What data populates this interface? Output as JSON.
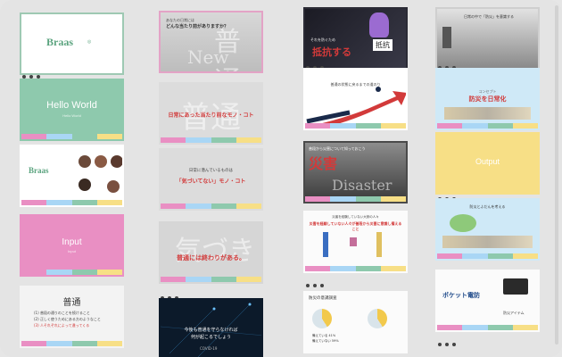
{
  "col1": {
    "s1": {
      "logo": "Braas"
    },
    "s2": {
      "title": "Hello World",
      "sub": "Hello World"
    },
    "s3": {
      "logo": "Braas"
    },
    "s4": {
      "title": "Input",
      "sub": "Input"
    },
    "s5": {
      "heading": "普通",
      "lines": [
        "(1) 普段の通りのことを続けること",
        "(2) 正しく使うためにある方のようなこと",
        "(3) 人それぞれによって違ってくる"
      ]
    }
  },
  "col2": {
    "s1": {
      "line1": "あなたの日常には",
      "line2": "どんな当たり前がありますか？",
      "wm1": "普通",
      "wm2": "New"
    },
    "s2": {
      "caption": "日常にあった当たり前なモノ・コト",
      "wm": "普通"
    },
    "s3": {
      "line1": "日常に潜んでいるものは",
      "line2": "「気づいてない」モノ・コト"
    },
    "s4": {
      "wm": "気づき",
      "caption": "普通には終わりがある。"
    },
    "s5": {
      "line1": "今後も普通を守らなければ",
      "line2": "何が起こるでしょう",
      "tag": "COVID-19"
    }
  },
  "col3": {
    "s1": {
      "title": "抵抗する",
      "label": "抵抗",
      "small": "それを防ぐため"
    },
    "s2": {
      "caption": "普通の状態に戻るまでの道のり"
    },
    "s3": {
      "title": "災害",
      "small": "普段から災害について知っておこう",
      "wm": "Disaster"
    },
    "s4": {
      "top": "災害を経験していない人々が普段から災害に意識し備えること",
      "head": "災害を経験していない大勢の人々"
    },
    "s5": {
      "title": "防災の意識調査",
      "labels": [
        "備えている 41%",
        "備えていない 59%"
      ]
    }
  },
  "col4": {
    "s1": {
      "caption": "日常の中で「防災」を意識する"
    },
    "s2": {
      "small": "コンセプト",
      "title": "防災を日常化"
    },
    "s3": {
      "title": "Output"
    },
    "s4": {
      "title": "防災とふだんを考える"
    },
    "s5": {
      "brand": "ポケット電防",
      "small": "防災アイテム"
    }
  },
  "colors": {
    "green": "#8ec9ad",
    "pink": "#e98fc3",
    "red": "#d23a3a",
    "yellow": "#f7df86",
    "sky": "#a9d6f5"
  }
}
